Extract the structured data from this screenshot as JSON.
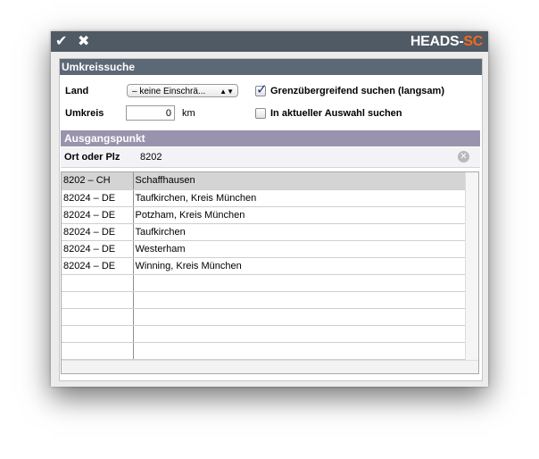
{
  "window": {
    "brand_main": "HEADS-",
    "brand_accent": "SC",
    "accent_color": "#f26a21",
    "titlebar_color": "#4f5a64",
    "confirm_icon": "check-icon",
    "close_icon": "close-icon"
  },
  "umkreis": {
    "header": "Umkreissuche",
    "land_label": "Land",
    "land_value": "– keine Einschrä...",
    "umkreis_label": "Umkreis",
    "umkreis_value": "0",
    "unit": "km",
    "cross_border_label": "Grenzübergreifend suchen (langsam)",
    "cross_border_checked": true,
    "current_selection_label": "In aktueller Auswahl suchen",
    "current_selection_checked": false
  },
  "ausgangspunkt": {
    "header": "Ausgangspunkt",
    "search_label": "Ort oder Plz",
    "search_value": "8202",
    "header_color": "#9a93ad"
  },
  "results": {
    "rows": [
      {
        "code": "8202 – CH",
        "place": "Schaffhausen",
        "selected": true
      },
      {
        "code": "82024 – DE",
        "place": "Taufkirchen, Kreis München",
        "selected": false
      },
      {
        "code": "82024 – DE",
        "place": "Potzham, Kreis München",
        "selected": false
      },
      {
        "code": "82024 – DE",
        "place": "Taufkirchen",
        "selected": false
      },
      {
        "code": "82024 – DE",
        "place": "Westerham",
        "selected": false
      },
      {
        "code": "82024 – DE",
        "place": "Winning, Kreis München",
        "selected": false
      }
    ],
    "empty_rows": 5
  }
}
